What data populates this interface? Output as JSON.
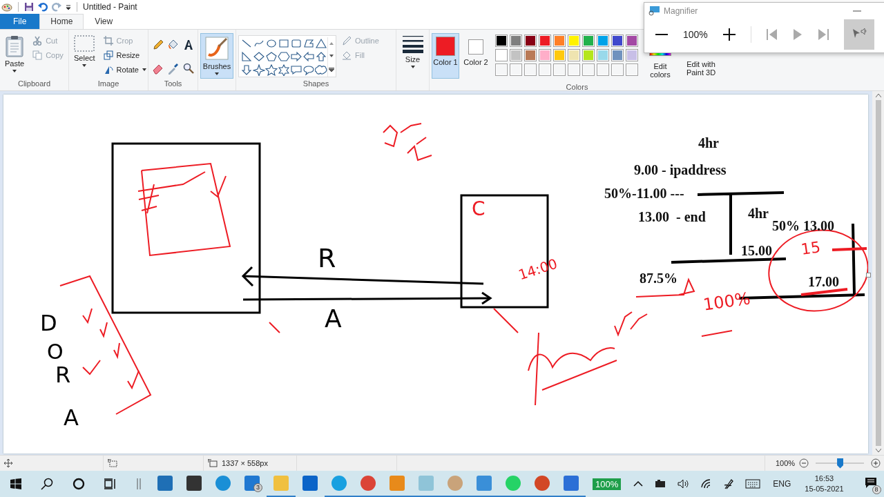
{
  "title_bar": {
    "title": "Untitled - Paint"
  },
  "tabs": [
    {
      "label": "File",
      "kind": "file",
      "selected": false
    },
    {
      "label": "Home",
      "kind": "tab",
      "selected": true
    },
    {
      "label": "View",
      "kind": "tab",
      "selected": false
    }
  ],
  "ribbon": {
    "clipboard": {
      "paste": "Paste",
      "cut": {
        "label": "Cut",
        "disabled": true
      },
      "copy": {
        "label": "Copy",
        "disabled": true
      },
      "group": "Clipboard"
    },
    "image": {
      "select": "Select",
      "crop": {
        "label": "Crop",
        "disabled": true
      },
      "resize": {
        "label": "Resize",
        "disabled": false
      },
      "rotate": {
        "label": "Rotate",
        "disabled": false
      },
      "group": "Image"
    },
    "tools": {
      "group": "Tools"
    },
    "brushes": {
      "label": "Brushes",
      "selected": true
    },
    "shapes": {
      "outline": {
        "label": "Outline",
        "disabled": true
      },
      "fill": {
        "label": "Fill",
        "disabled": true
      },
      "group": "Shapes"
    },
    "size": {
      "label": "Size"
    },
    "colors": {
      "slots": [
        {
          "label": "Color 1",
          "color": "#ed1c24",
          "selected": true
        },
        {
          "label": "Color 2",
          "color": "#ffffff",
          "selected": false
        }
      ],
      "palette": [
        {
          "color": "#000000"
        },
        {
          "color": "#7f7f7f"
        },
        {
          "color": "#880015"
        },
        {
          "color": "#ed1c24"
        },
        {
          "color": "#ff7f27"
        },
        {
          "color": "#fff200"
        },
        {
          "color": "#22b14c"
        },
        {
          "color": "#00a2e8"
        },
        {
          "color": "#3f48cc"
        },
        {
          "color": "#a349a4"
        },
        {
          "color": "#ffffff"
        },
        {
          "color": "#c3c3c3"
        },
        {
          "color": "#b97a57"
        },
        {
          "color": "#ffaec9"
        },
        {
          "color": "#ffc90e"
        },
        {
          "color": "#efe4b0"
        },
        {
          "color": "#b5e61d"
        },
        {
          "color": "#99d9ea"
        },
        {
          "color": "#7092be"
        },
        {
          "color": "#c8bfe7"
        }
      ],
      "group": "Colors",
      "edit_colors": "Edit colors",
      "edit_3d": "Edit with Paint 3D"
    }
  },
  "magnifier": {
    "title": "Magnifier",
    "zoom": "100%"
  },
  "canvas": {
    "texts": [
      {
        "text": "4hr",
        "kind": "typed"
      },
      {
        "text": "9.00 - ipaddress",
        "kind": "typed"
      },
      {
        "text": "50%-11.00 ---",
        "kind": "typed"
      },
      {
        "text": "C",
        "kind": "handwritten",
        "color": "#ed1c24"
      },
      {
        "text": "13.00  - end",
        "kind": "typed"
      },
      {
        "text": "4hr",
        "kind": "typed"
      },
      {
        "text": "50% 13.00",
        "kind": "typed"
      },
      {
        "text": "R",
        "kind": "handwritten",
        "color": "#000000"
      },
      {
        "text": "15.00",
        "kind": "typed"
      },
      {
        "text": "15",
        "kind": "handwritten",
        "color": "#ed1c24"
      },
      {
        "text": "14:00",
        "kind": "handwritten",
        "color": "#ed1c24"
      },
      {
        "text": "87.5%",
        "kind": "typed"
      },
      {
        "text": "17.00",
        "kind": "typed"
      },
      {
        "text": "100%",
        "kind": "handwritten",
        "color": "#ed1c24"
      },
      {
        "text": "D",
        "kind": "handwritten",
        "color": "#000000"
      },
      {
        "text": "A",
        "kind": "handwritten",
        "color": "#000000"
      },
      {
        "text": "O",
        "kind": "handwritten",
        "color": "#000000"
      },
      {
        "text": "R",
        "kind": "handwritten",
        "color": "#000000"
      },
      {
        "text": "A",
        "kind": "handwritten",
        "color": "#000000"
      }
    ]
  },
  "status_bar": {
    "image_size": "1337 × 558px",
    "zoom": "100%",
    "zoom_slider": {
      "level": 0.5
    }
  },
  "taskbar": {
    "apps": [
      {
        "kind": "monitor",
        "running": false
      },
      {
        "kind": "store",
        "running": false
      },
      {
        "kind": "edge",
        "running": false
      },
      {
        "kind": "mail",
        "running": false,
        "badge": "3"
      },
      {
        "kind": "folder",
        "running": true
      },
      {
        "kind": "outlook",
        "running": false
      },
      {
        "kind": "skype",
        "running": true
      },
      {
        "kind": "chrome",
        "running": true
      },
      {
        "kind": "vbox",
        "running": true
      },
      {
        "kind": "notepad",
        "running": true
      },
      {
        "kind": "paint",
        "running": true
      },
      {
        "kind": "magnifier",
        "running": true
      },
      {
        "kind": "whatsapp",
        "running": true
      },
      {
        "kind": "powerpoint",
        "running": true
      },
      {
        "kind": "camera",
        "running": true
      }
    ],
    "battery": "100%",
    "language": "ENG",
    "time": "16:53",
    "date": "15-05-2021",
    "notifications": "8"
  }
}
